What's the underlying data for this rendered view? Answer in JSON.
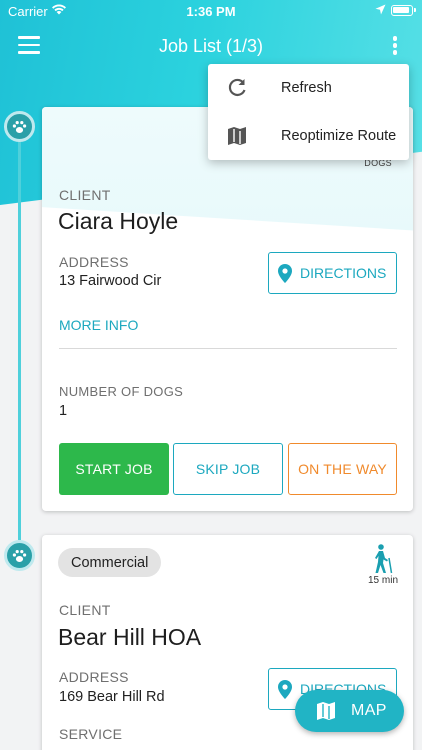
{
  "status_bar": {
    "carrier": "Carrier",
    "time": "1:36 PM"
  },
  "app_bar": {
    "title": "Job List (1/3)"
  },
  "popup_menu": {
    "items": [
      {
        "label": "Refresh",
        "icon": "refresh-icon"
      },
      {
        "label": "Reoptimize Route",
        "icon": "map-icon"
      }
    ]
  },
  "jobs": [
    {
      "dogs_tag": "DOGS",
      "client_label": "CLIENT",
      "client": "Ciara Hoyle",
      "address_label": "ADDRESS",
      "address": "13 Fairwood Cir",
      "directions_label": "DIRECTIONS",
      "more_info_label": "MORE INFO",
      "dogs_label": "NUMBER OF DOGS",
      "dogs": "1",
      "actions": {
        "start": "START JOB",
        "skip": "SKIP JOB",
        "on_the_way": "ON THE WAY"
      }
    },
    {
      "badge": "Commercial",
      "walk_time": "15 min",
      "client_label": "CLIENT",
      "client": "Bear Hill HOA",
      "address_label": "ADDRESS",
      "address": "169 Bear Hill Rd",
      "directions_label": "DIRECTIONS",
      "service_label": "SERVICE"
    }
  ],
  "fab": {
    "label": "MAP"
  },
  "colors": {
    "accent": "#1ca8bf",
    "start": "#2db84b",
    "on_the_way": "#f08a2c",
    "header": "#2bd2de"
  }
}
